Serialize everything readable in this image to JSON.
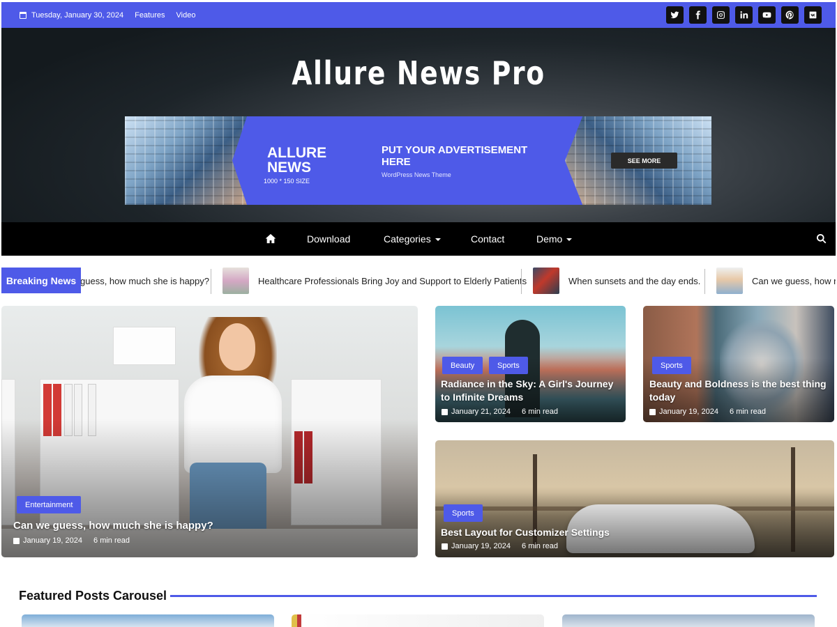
{
  "topbar": {
    "date": "Tuesday, January 30, 2024",
    "links": [
      "Features",
      "Video"
    ],
    "socials": [
      "twitter-icon",
      "facebook-icon",
      "instagram-icon",
      "linkedin-icon",
      "youtube-icon",
      "pinterest-icon",
      "vk-icon"
    ]
  },
  "header": {
    "site_title": "Allure News Pro"
  },
  "banner": {
    "brand_line1": "ALLURE",
    "brand_line2": "NEWS",
    "size": "1000 * 150 SIZE",
    "headline": "PUT YOUR ADVERTISEMENT HERE",
    "sub": "WordPress News Theme",
    "cta": "SEE MORE"
  },
  "nav": {
    "items": [
      {
        "label": "Download"
      },
      {
        "label": "Categories"
      },
      {
        "label": "Contact"
      },
      {
        "label": "Demo"
      }
    ]
  },
  "ticker": {
    "label": "Breaking News",
    "items": [
      "guess, how much she is happy?",
      "Healthcare Professionals Bring Joy and Support to Elderly Patients",
      "When sunsets and the day ends.",
      "Can we guess, how m"
    ]
  },
  "posts": {
    "main": {
      "tag": "Entertainment",
      "title": "Can we guess, how much she is happy?",
      "date": "January 19, 2024",
      "read": "6 min read"
    },
    "p2": {
      "tags": [
        "Beauty",
        "Sports"
      ],
      "title": "Radiance in the Sky: A Girl's Journey to Infinite Dreams",
      "date": "January 21, 2024",
      "read": "6 min read"
    },
    "p3": {
      "tags": [
        "Sports"
      ],
      "title": "Beauty and Boldness is the best thing today",
      "date": "January 19, 2024",
      "read": "6 min read"
    },
    "p4": {
      "tags": [
        "Sports"
      ],
      "title": "Best Layout for Customizer Settings",
      "date": "January 19, 2024",
      "read": "6 min read"
    }
  },
  "featured": {
    "title": "Featured Posts Carousel"
  },
  "colors": {
    "accent": "#4e5ae8",
    "nav_bg": "#000000"
  }
}
